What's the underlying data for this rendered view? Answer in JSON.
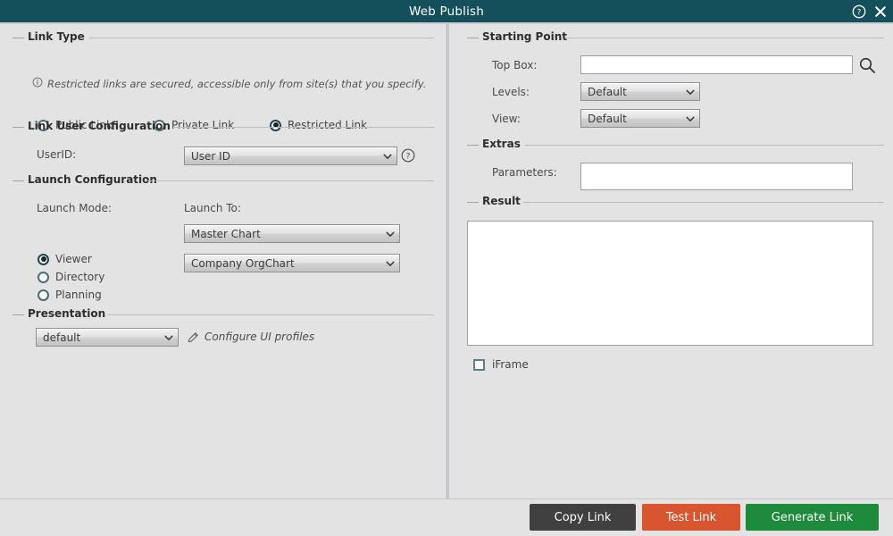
{
  "window": {
    "title": "Web Publish",
    "help_icon": "help-circle-icon",
    "close_icon": "close-icon",
    "titlebar_color": "#14505c",
    "background_color": "#e3e3e3"
  },
  "link_type": {
    "group_title": "Link Type",
    "info_icon": "info-circle-icon",
    "hint": "Restricted links are secured, accessible only from site(s) that you specify.",
    "options": [
      {
        "label": "Public Link",
        "selected": false
      },
      {
        "label": "Private Link",
        "selected": false
      },
      {
        "label": "Restricted Link",
        "selected": true
      }
    ]
  },
  "link_user_configuration": {
    "group_title": "Link User Configuration",
    "userid_label": "UserID:",
    "userid_value": "User ID",
    "userid_help_icon": "help-circle-icon"
  },
  "launch_configuration": {
    "group_title": "Launch Configuration",
    "launch_mode_label": "Launch Mode:",
    "launch_to_label": "Launch To:",
    "modes": [
      {
        "label": "Viewer",
        "selected": true
      },
      {
        "label": "Directory",
        "selected": false
      },
      {
        "label": "Planning",
        "selected": false
      }
    ],
    "launch_to_primary": "Master Chart",
    "launch_to_secondary": "Company OrgChart"
  },
  "presentation": {
    "group_title": "Presentation",
    "profile_value": "default",
    "configure_icon": "pencil-icon",
    "configure_label": "Configure UI profiles"
  },
  "starting_point": {
    "group_title": "Starting Point",
    "top_box_label": "Top Box:",
    "top_box_value": "",
    "top_box_placeholder": "",
    "search_icon": "search-icon",
    "levels_label": "Levels:",
    "levels_value": "Default",
    "view_label": "View:",
    "view_value": "Default"
  },
  "extras": {
    "group_title": "Extras",
    "parameters_label": "Parameters:",
    "parameters_value": "",
    "parameters_placeholder": ""
  },
  "result": {
    "group_title": "Result",
    "value": "",
    "placeholder": "",
    "iframe_label": "iFrame",
    "iframe_checked": false
  },
  "footer": {
    "copy_label": "Copy Link",
    "test_label": "Test Link",
    "generate_label": "Generate Link",
    "copy_color": "#404040",
    "test_color": "#d9552f",
    "generate_color": "#1e8b3c"
  }
}
